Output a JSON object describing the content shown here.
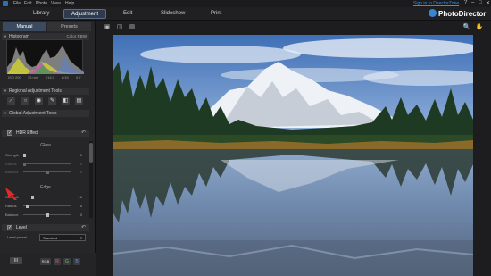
{
  "menubar": {
    "items": [
      "File",
      "Edit",
      "Photo",
      "View",
      "Help"
    ],
    "signin": "Sign in to DirectorZone",
    "window_controls": [
      "?",
      "–",
      "□",
      "✕"
    ]
  },
  "modebar": {
    "modes": [
      "Library",
      "Adjustment",
      "Edit",
      "Slideshow",
      "Print"
    ],
    "active": "Adjustment",
    "brand": "PhotoDirector"
  },
  "panel": {
    "tabs": [
      "Manual",
      "Presets"
    ],
    "histogram": {
      "title": "Histogram",
      "right": "Color  RBW",
      "labels": [
        "ISO 200",
        "35 mm",
        "f/16.0",
        "1/15",
        "0.7"
      ]
    },
    "regional": "Regional Adjustment Tools",
    "global": "Global Adjustment Tools",
    "hdr": {
      "title": "HDR Effect",
      "glow_title": "Glow",
      "glow": [
        {
          "label": "Strength",
          "value": "0"
        },
        {
          "label": "Radius",
          "value": "0"
        },
        {
          "label": "Balance",
          "value": "0"
        }
      ],
      "edge_title": "Edge",
      "edge": [
        {
          "label": "Strength",
          "value": "16"
        },
        {
          "label": "Radius",
          "value": "5"
        },
        {
          "label": "Balance",
          "value": "0"
        }
      ]
    },
    "level": {
      "title": "Level",
      "preset_label": "Level preset",
      "preset_value": "Standard"
    },
    "bottom": {
      "compare_label": "ΙΙΙ",
      "channels": [
        "RGB",
        "R",
        "G",
        "B"
      ]
    }
  },
  "colors": {
    "accent": "#3c4a60",
    "link": "#3d8fd6"
  }
}
